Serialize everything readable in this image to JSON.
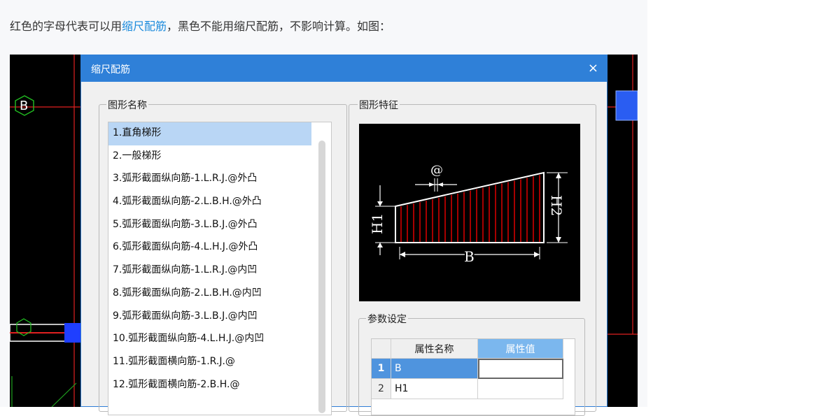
{
  "intro": {
    "before": "红色的字母代表可以用",
    "link": "缩尺配筋",
    "after": "，黑色不能用缩尺配筋，不影响计算。如图："
  },
  "cad": {
    "axis_label": "B"
  },
  "dialog": {
    "title": "缩尺配筋",
    "close_glyph": "×",
    "shape_name_group": "图形名称",
    "shape_feature_group": "图形特征",
    "param_group": "参数设定",
    "shapes": [
      "1.直角梯形",
      "2.一般梯形",
      "3.弧形截面纵向筋-1.L.R.J.@外凸",
      "4.弧形截面纵向筋-2.L.B.H.@外凸",
      "5.弧形截面纵向筋-3.L.B.J.@外凸",
      "6.弧形截面纵向筋-4.L.H.J.@外凸",
      "7.弧形截面纵向筋-1.L.R.J.@内凹",
      "8.弧形截面纵向筋-2.L.B.H.@内凹",
      "9.弧形截面纵向筋-3.L.B.J.@内凹",
      "10.弧形截面纵向筋-4.L.H.J.@内凹",
      "11.弧形截面横向筋-1.R.J.@",
      "12.弧形截面横向筋-2.B.H.@"
    ],
    "selected_index": 0,
    "diagram_labels": {
      "spacing": "@",
      "h1": "H1",
      "h2": "H2",
      "b": "B"
    },
    "grid": {
      "col_name": "属性名称",
      "col_value": "属性值",
      "rows": [
        {
          "no": "1",
          "name": "B",
          "value": ""
        },
        {
          "no": "2",
          "name": "H1",
          "value": ""
        }
      ]
    }
  },
  "colors": {
    "title_bar": "#2f80d8",
    "link": "#1c8bdc",
    "rebar": "#ff0000",
    "selection": "#b9d6f5"
  }
}
